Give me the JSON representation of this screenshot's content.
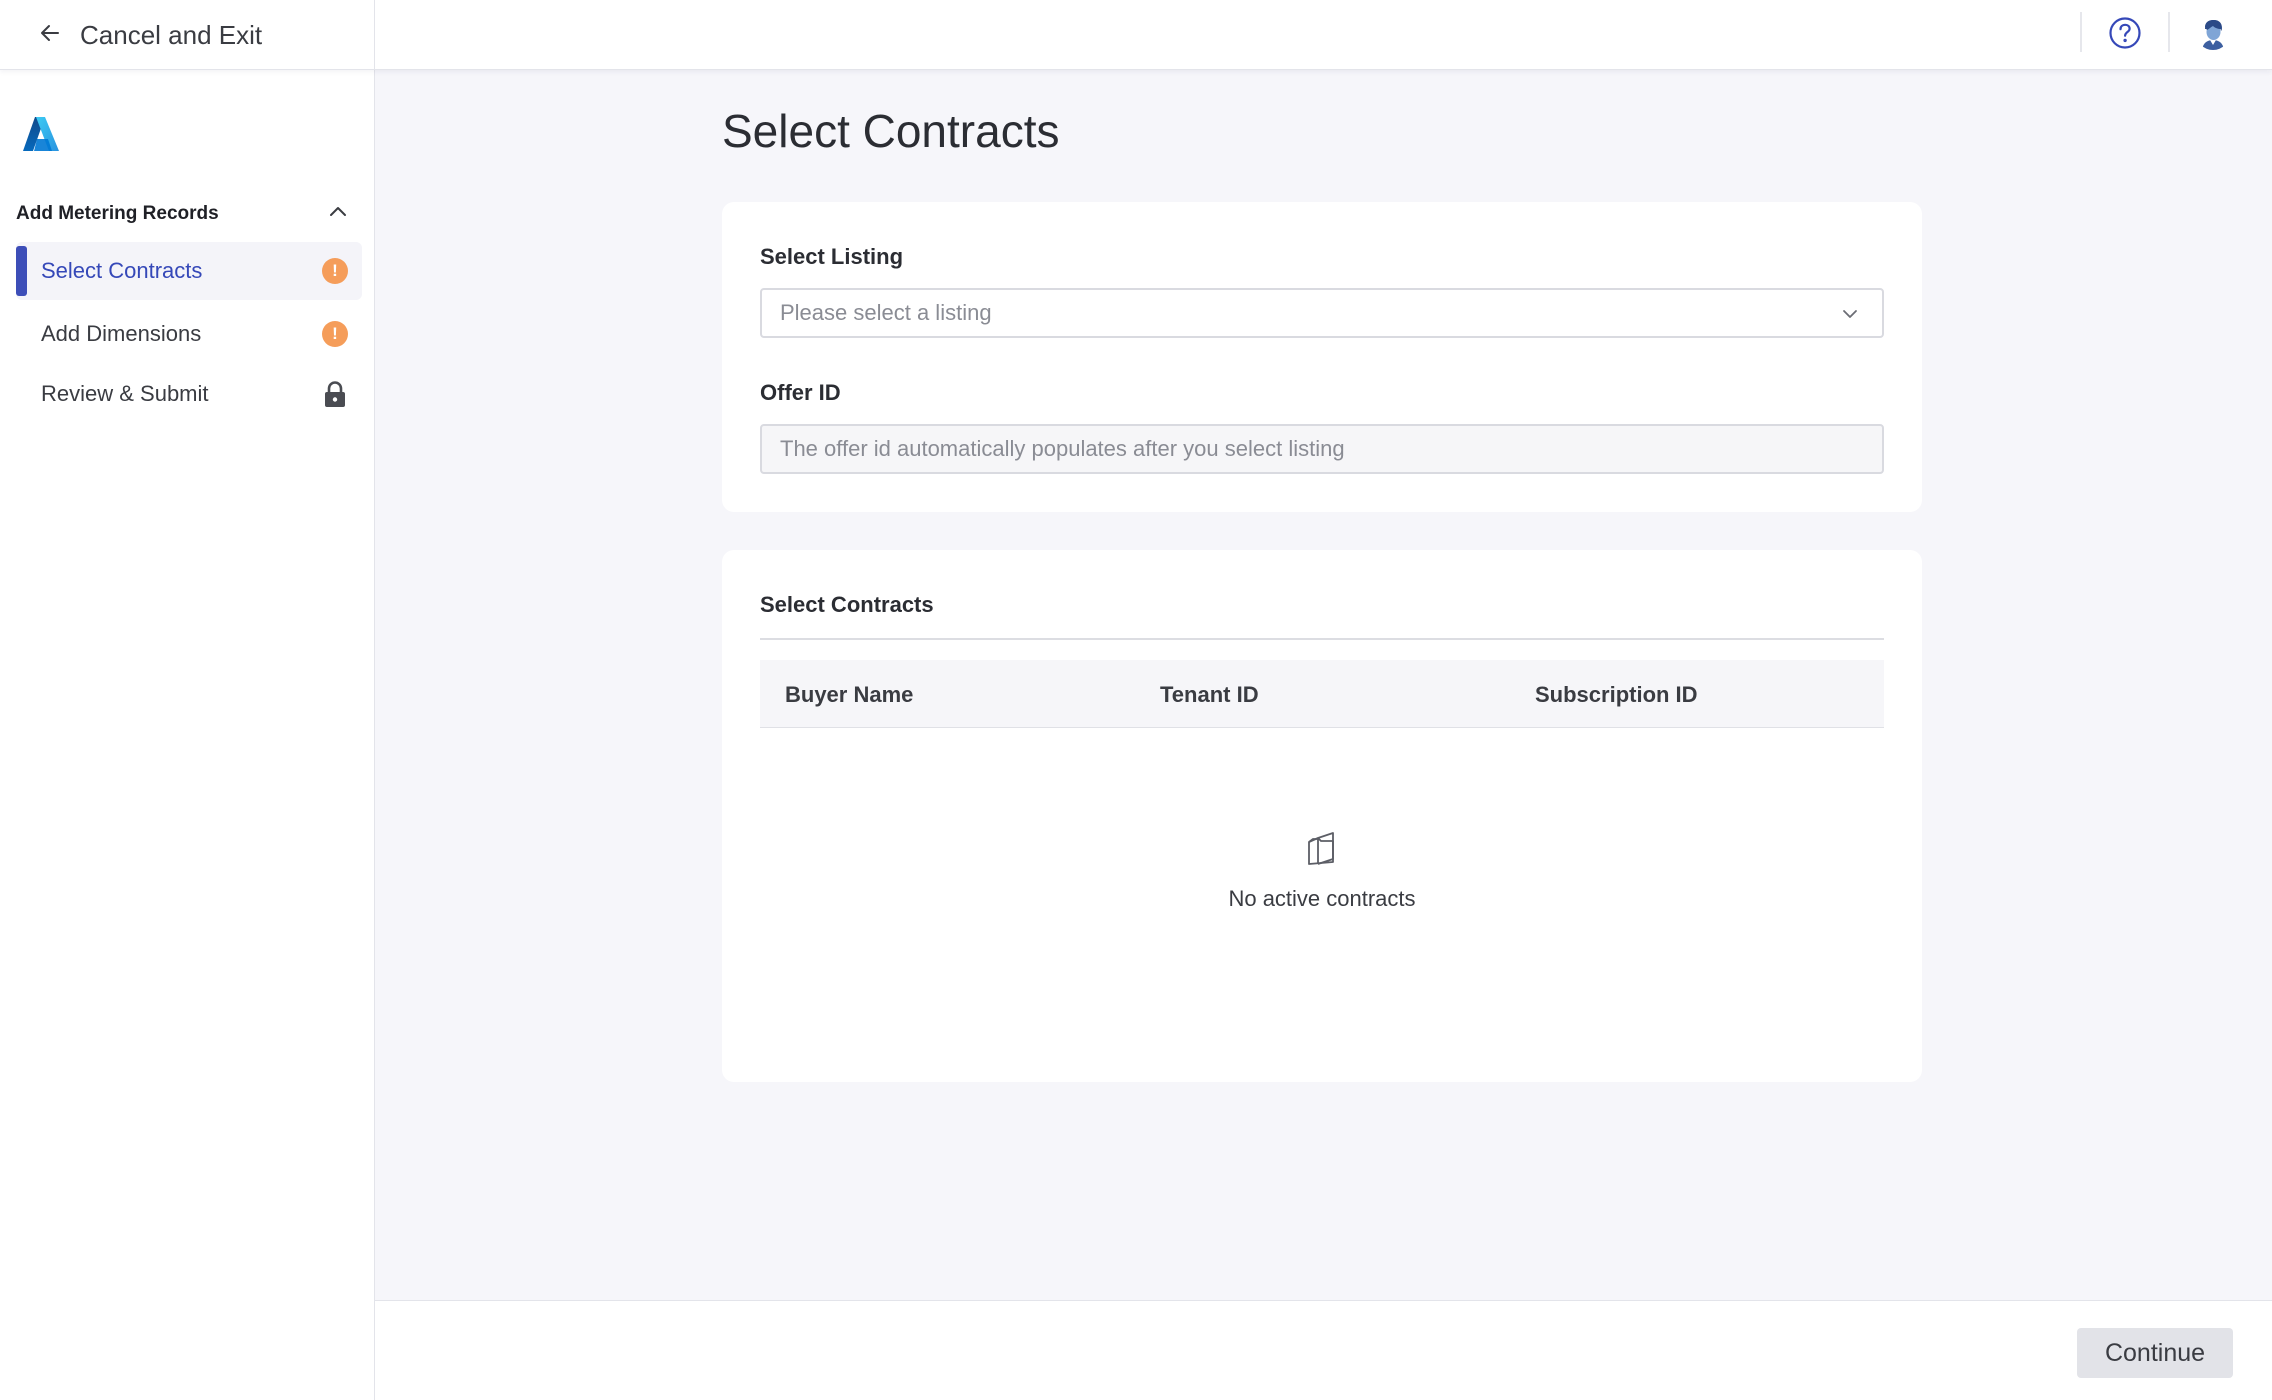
{
  "header": {
    "cancel_label": "Cancel and Exit",
    "icons": {
      "back": "arrow-left-icon",
      "help": "question-circle-icon",
      "avatar": "user-avatar"
    }
  },
  "sidebar": {
    "logo": "azure-logo",
    "section_title": "Add Metering Records",
    "section_expanded": true,
    "items": [
      {
        "label": "Select Contracts",
        "status": "warning",
        "active": true
      },
      {
        "label": "Add Dimensions",
        "status": "warning",
        "active": false
      },
      {
        "label": "Review & Submit",
        "status": "locked",
        "active": false
      }
    ],
    "warning_glyph": "!"
  },
  "main": {
    "title": "Select Contracts",
    "listing": {
      "label": "Select Listing",
      "placeholder": "Please select a listing"
    },
    "offer": {
      "label": "Offer ID",
      "placeholder": "The offer id automatically populates after you select listing"
    },
    "contracts": {
      "title": "Select Contracts",
      "columns": [
        "Buyer Name",
        "Tenant ID",
        "Subscription ID"
      ],
      "rows": [],
      "empty_text": "No active contracts"
    }
  },
  "footer": {
    "continue_label": "Continue"
  },
  "colors": {
    "accent": "#3d4eb8",
    "warning": "#f59d5a",
    "background": "#f6f6fa"
  }
}
